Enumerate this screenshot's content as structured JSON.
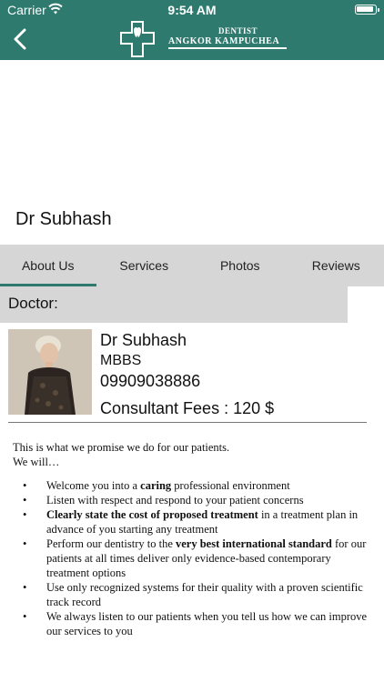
{
  "status_bar": {
    "carrier": "Carrier",
    "time": "9:54 AM"
  },
  "header": {
    "logo_line1": "DENTIST",
    "logo_line2": "ANGKOR KAMPUCHEA",
    "back_icon": "chevron-left-icon",
    "background": "#2e7a6e"
  },
  "doctor": {
    "title": "Dr Subhash",
    "name": "Dr Subhash",
    "degree": "MBBS",
    "phone": "09909038886",
    "fees": "Consultant Fees : 120 $"
  },
  "tabs": [
    {
      "label": "About Us",
      "active": true
    },
    {
      "label": "Services",
      "active": false
    },
    {
      "label": "Photos",
      "active": false
    },
    {
      "label": "Reviews",
      "active": false
    }
  ],
  "section_label": "Doctor:",
  "description": {
    "intro1": "This is what we promise we do for our patients.",
    "intro2": "We will…",
    "items": [
      {
        "pre": "Welcome you into a ",
        "bold": "caring",
        "post": " professional environment"
      },
      {
        "pre": "Listen with respect and respond to your patient concerns",
        "bold": "",
        "post": ""
      },
      {
        "pre": "",
        "bold": "Clearly state the cost of proposed treatment",
        "post": " in a treatment plan in advance of you starting any treatment"
      },
      {
        "pre": "Perform our dentistry to the ",
        "bold": "very best international standard",
        "post": " for our patients at all times deliver only evidence-based contemporary treatment options"
      },
      {
        "pre": "Use only recognized systems for their quality with a proven scientific track record",
        "bold": "",
        "post": ""
      },
      {
        "pre": "We always listen to our patients when you tell us how we can improve our services to you",
        "bold": "",
        "post": ""
      }
    ]
  },
  "colors": {
    "accent": "#2e7a6e",
    "tab_bar": "#d6d6d6"
  }
}
